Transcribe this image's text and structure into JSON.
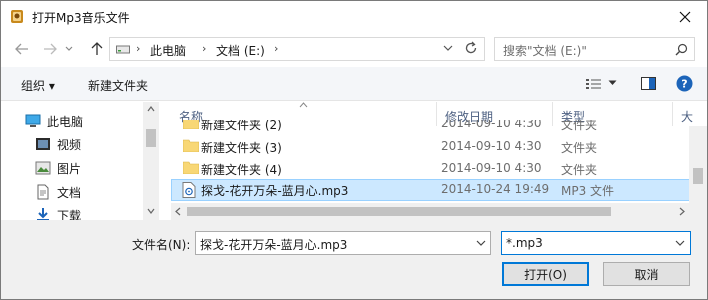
{
  "window": {
    "title": "打开Mp3音乐文件"
  },
  "address": {
    "crumbs": [
      "此电脑",
      "文档 (E:)"
    ]
  },
  "search": {
    "placeholder": "搜索\"文档 (E:)\""
  },
  "toolbar": {
    "organize_label": "组织 ▾",
    "new_folder_label": "新建文件夹"
  },
  "nav_pane": {
    "items": [
      {
        "label": "此电脑",
        "icon": "computer-icon"
      },
      {
        "label": "视频",
        "icon": "video-folder-icon"
      },
      {
        "label": "图片",
        "icon": "pictures-folder-icon"
      },
      {
        "label": "文档",
        "icon": "documents-folder-icon"
      },
      {
        "label": "下载",
        "icon": "downloads-folder-icon"
      }
    ]
  },
  "file_list": {
    "columns": [
      "名称",
      "修改日期",
      "类型",
      "大"
    ],
    "rows": [
      {
        "name": "新建文件夹 (2)",
        "date": "2014-09-10 4:30",
        "type": "文件夹",
        "kind": "folder"
      },
      {
        "name": "新建文件夹 (3)",
        "date": "2014-09-10 4:30",
        "type": "文件夹",
        "kind": "folder"
      },
      {
        "name": "新建文件夹 (4)",
        "date": "2014-09-10 4:30",
        "type": "文件夹",
        "kind": "folder"
      },
      {
        "name": "探戈-花开万朵-蓝月心.mp3",
        "date": "2014-10-24 19:49",
        "type": "MP3 文件",
        "kind": "mp3",
        "selected": true
      }
    ]
  },
  "bottom": {
    "filename_label": "文件名(N):",
    "filename_value": "探戈-花开万朵-蓝月心.mp3",
    "filetype_value": "*.mp3",
    "open_label": "打开(O)",
    "cancel_label": "取消"
  },
  "colors": {
    "selection_bg": "#cce8ff",
    "accent": "#0078d7",
    "folder": "#f8d775",
    "help_icon": "#1c64b9"
  }
}
